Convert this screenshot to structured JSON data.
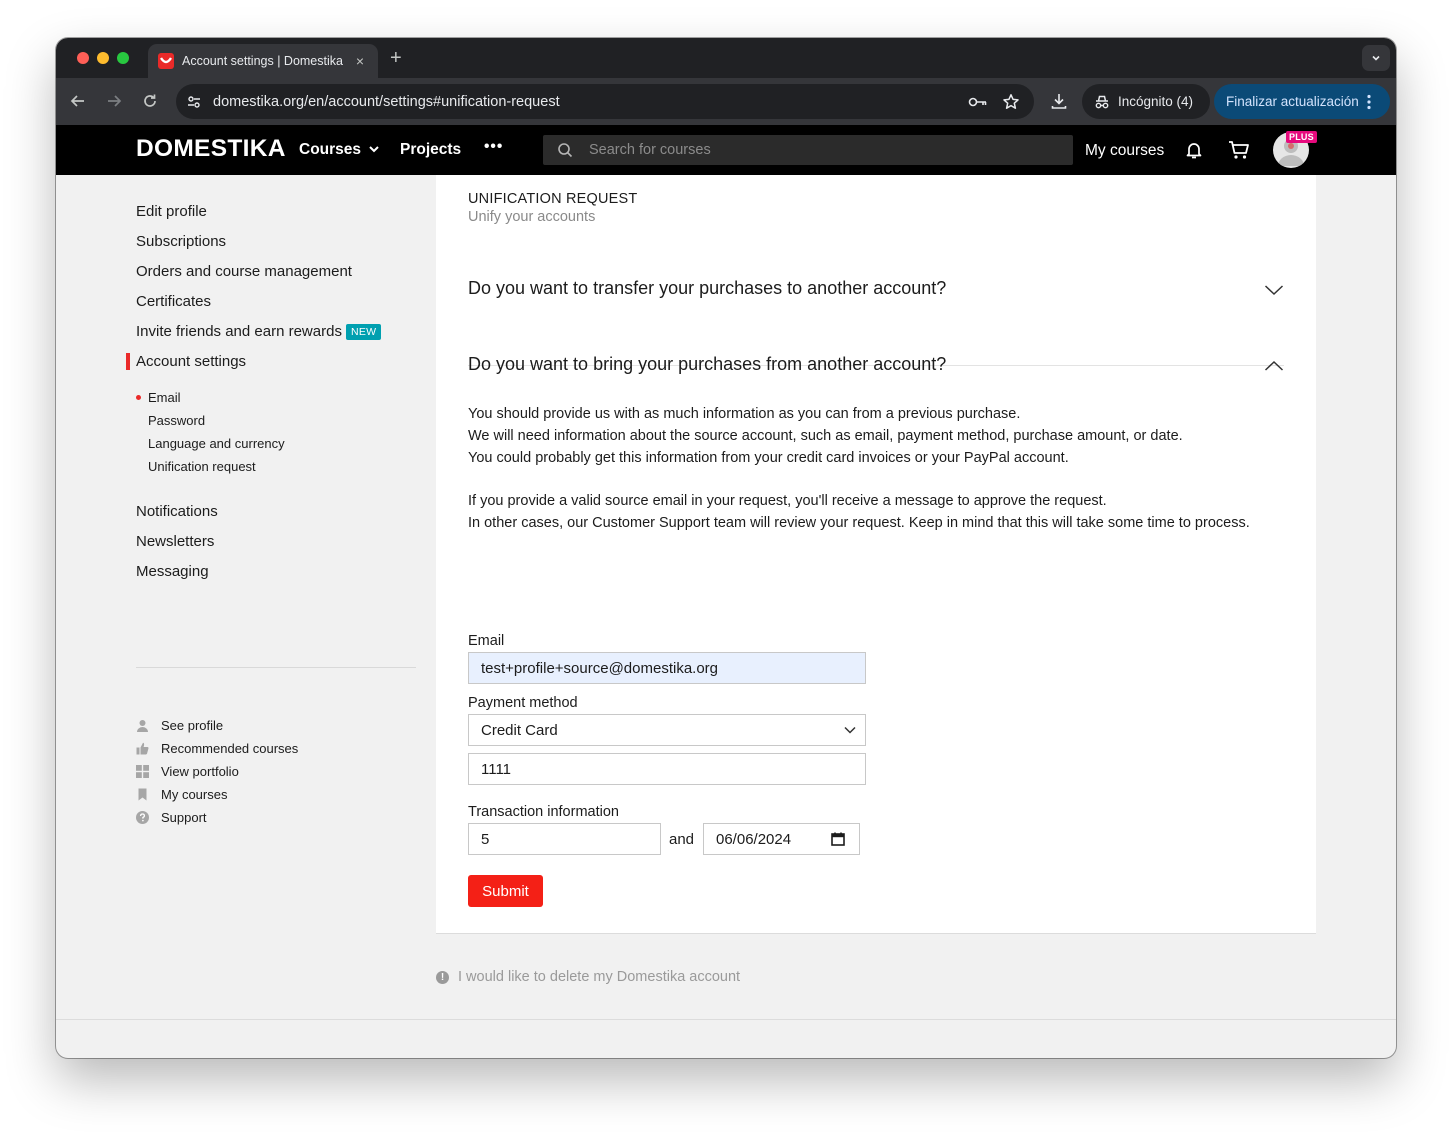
{
  "browser": {
    "tab_title": "Account settings | Domestika",
    "tab_close": "×",
    "new_tab": "+",
    "url": "domestika.org/en/account/settings#unification-request",
    "incognito_label": "Incógnito (4)",
    "update_label": "Finalizar actualización"
  },
  "header": {
    "logo": "DOMESTIKA",
    "nav": [
      "Courses",
      "Projects"
    ],
    "more": "•••",
    "search_placeholder": "Search for courses",
    "my_courses": "My courses",
    "plus_badge": "PLUS"
  },
  "sidebar": {
    "items": [
      {
        "label": "Edit profile"
      },
      {
        "label": "Subscriptions"
      },
      {
        "label": "Orders and course management"
      },
      {
        "label": "Certificates"
      },
      {
        "label": "Invite friends and earn rewards",
        "badge": "NEW"
      },
      {
        "label": "Account settings",
        "active": true
      },
      {
        "label": "Notifications"
      },
      {
        "label": "Newsletters"
      },
      {
        "label": "Messaging"
      }
    ],
    "subitems": [
      {
        "label": "Email",
        "active": true
      },
      {
        "label": "Password"
      },
      {
        "label": "Language and currency"
      },
      {
        "label": "Unification request"
      }
    ],
    "utility": [
      {
        "label": "See profile",
        "icon": "user-icon"
      },
      {
        "label": "Recommended courses",
        "icon": "thumbs-up-icon"
      },
      {
        "label": "View portfolio",
        "icon": "grid-icon"
      },
      {
        "label": "My courses",
        "icon": "bookmark-icon"
      },
      {
        "label": "Support",
        "icon": "question-icon"
      }
    ]
  },
  "main": {
    "section_title": "UNIFICATION REQUEST",
    "section_subtitle": "Unify your accounts",
    "accordion": [
      {
        "question": "Do you want to transfer your purchases to another account?",
        "expanded": false
      },
      {
        "question": "Do you want to bring your purchases from another account?",
        "expanded": true
      }
    ],
    "paragraph1": [
      "You should provide us with as much information as you can from a previous purchase.",
      "We will need information about the source account, such as email, payment method, purchase amount, or date.",
      "You could probably get this information from your credit card invoices or your PayPal account."
    ],
    "paragraph2": [
      "If you provide a valid source email in your request, you'll receive a message to approve the request.",
      "In other cases, our Customer Support team will review your request. Keep in mind that this will take some time to process."
    ],
    "form": {
      "email_label": "Email",
      "email_value": "test+profile+source@domestika.org",
      "payment_label": "Payment method",
      "payment_value": "Credit Card",
      "card_value": "1111",
      "transaction_label": "Transaction information",
      "amount_value": "5",
      "and_text": "and",
      "date_value": "06/06/2024",
      "submit_label": "Submit"
    },
    "delete_account": "I would like to delete my Domestika account"
  },
  "colors": {
    "brand_red": "#f42016",
    "accent_teal": "#00a0b0",
    "plus_pink": "#e60a7d"
  }
}
